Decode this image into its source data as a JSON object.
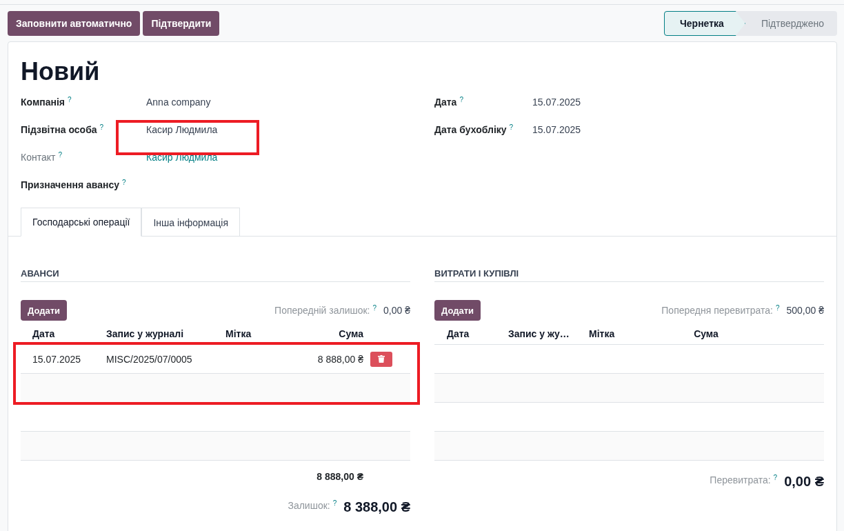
{
  "toolbar": {
    "buttons": [
      "Заповнити автоматично",
      "Підтвердити"
    ]
  },
  "status_steps": [
    {
      "label": "Чернетка",
      "selected": true
    },
    {
      "label": "Підтверджено",
      "selected": false
    }
  ],
  "title": "Новий",
  "fields_left": [
    {
      "label": "Компанія",
      "help": "?",
      "value": "Anna company",
      "muted": false
    },
    {
      "label": "Підзвітна особа",
      "help": "?",
      "value": "Касир Людмила",
      "muted": false
    },
    {
      "label": "Контакт",
      "help": "?",
      "value": "Касир Людмила",
      "muted": true,
      "link": true
    },
    {
      "label": "Призначення авансу",
      "help": "?",
      "muted": false
    }
  ],
  "fields_right": [
    {
      "label": "Дата",
      "help": "?",
      "value": "15.07.2025",
      "muted": false
    },
    {
      "label": "Дата бухобліку",
      "help": "?",
      "value": "15.07.2025",
      "muted": false
    }
  ],
  "tabs": [
    {
      "label": "Господарські операції",
      "selected": true
    },
    {
      "label": "Інша інформація",
      "selected": false
    }
  ],
  "advances": {
    "heading": "АВАНСИ",
    "add_button": "Додати",
    "prev_label": "Попередній залишок:",
    "prev_help": "?",
    "prev_value": "0,00 ₴",
    "columns": [
      "Дата",
      "Запис у журналі",
      "Мітка",
      "Сума"
    ],
    "rows": [
      {
        "date": "15.07.2025",
        "entry": "MISC/2025/07/0005",
        "tag": "",
        "amount": "8 888,00 ₴"
      }
    ],
    "total": "8 888,00 ₴",
    "balance_label": "Залишок:",
    "balance_help": "?",
    "balance_value": "8 388,00 ₴"
  },
  "expenses": {
    "heading": "ВИТРАТИ І КУПІВЛІ",
    "add_button": "Додати",
    "prev_label": "Попередня перевитрата:",
    "prev_help": "?",
    "prev_value": "500,00 ₴",
    "columns": [
      "Дата",
      "Запис у жу…",
      "Мітка",
      "Сума"
    ],
    "overspend_label": "Перевитрата:",
    "overspend_help": "?",
    "overspend_value": "0,00 ₴"
  }
}
